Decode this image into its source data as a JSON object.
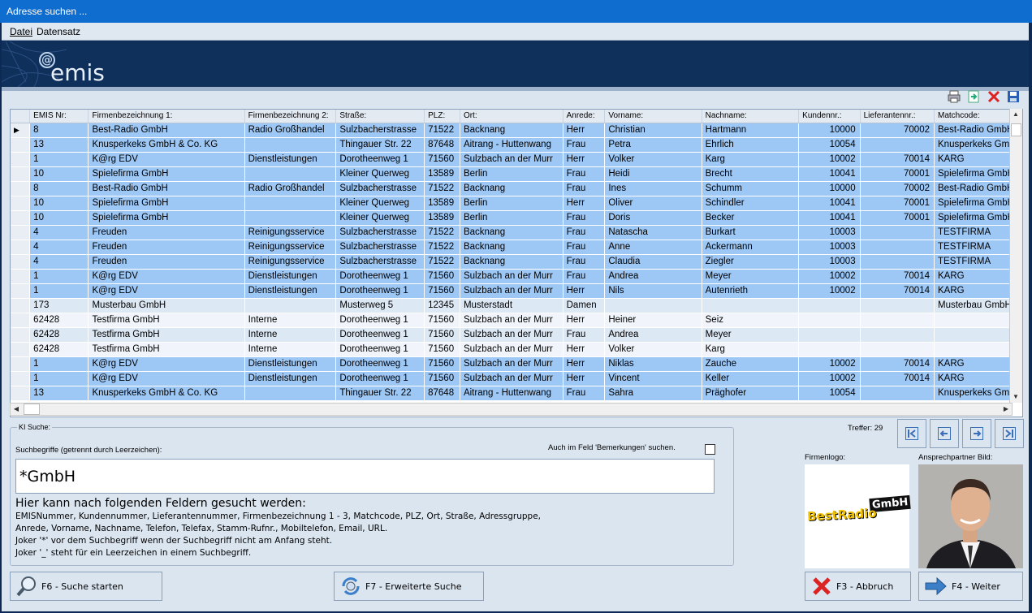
{
  "window": {
    "title": "Adresse suchen ..."
  },
  "menu": {
    "items": [
      "Datei",
      "Datensatz"
    ]
  },
  "logo": {
    "text": "emis"
  },
  "grid": {
    "columns": [
      "EMIS Nr:",
      "Firmenbezeichnung 1:",
      "Firmenbezeichnung 2:",
      "Straße:",
      "PLZ:",
      "Ort:",
      "Anrede:",
      "Vorname:",
      "Nachname:",
      "Kundennr.:",
      "Lieferantennr.:",
      "Matchcode:"
    ],
    "rows": [
      [
        "8",
        "Best-Radio GmbH",
        "Radio Großhandel",
        "Sulzbacherstrasse",
        "71522",
        "Backnang",
        "Herr",
        "Christian",
        "Hartmann",
        "10000",
        "70002",
        "Best-Radio GmbH"
      ],
      [
        "13",
        "Knusperkeks GmbH & Co. KG",
        "",
        "Thingauer Str. 22",
        "87648",
        "Aitrang - Huttenwang",
        "Frau",
        "Petra",
        "Ehrlich",
        "10054",
        "",
        "Knusperkeks GmbH"
      ],
      [
        "1",
        "K@rg EDV",
        "Dienstleistungen",
        "Dorotheenweg 1",
        "71560",
        "Sulzbach an der Murr",
        "Herr",
        "Volker",
        "Karg",
        "10002",
        "70014",
        "KARG"
      ],
      [
        "10",
        "Spielefirma GmbH",
        "",
        "Kleiner Querweg",
        "13589",
        "Berlin",
        "Frau",
        "Heidi",
        "Brecht",
        "10041",
        "70001",
        "Spielefirma GmbH"
      ],
      [
        "8",
        "Best-Radio GmbH",
        "Radio Großhandel",
        "Sulzbacherstrasse",
        "71522",
        "Backnang",
        "Frau",
        "Ines",
        "Schumm",
        "10000",
        "70002",
        "Best-Radio GmbH"
      ],
      [
        "10",
        "Spielefirma GmbH",
        "",
        "Kleiner Querweg",
        "13589",
        "Berlin",
        "Herr",
        "Oliver",
        "Schindler",
        "10041",
        "70001",
        "Spielefirma GmbH"
      ],
      [
        "10",
        "Spielefirma GmbH",
        "",
        "Kleiner Querweg",
        "13589",
        "Berlin",
        "Frau",
        "Doris",
        "Becker",
        "10041",
        "70001",
        "Spielefirma GmbH"
      ],
      [
        "4",
        "Freuden",
        "Reinigungsservice",
        "Sulzbacherstrasse",
        "71522",
        "Backnang",
        "Frau",
        "Natascha",
        "Burkart",
        "10003",
        "",
        "TESTFIRMA"
      ],
      [
        "4",
        "Freuden",
        "Reinigungsservice",
        "Sulzbacherstrasse",
        "71522",
        "Backnang",
        "Frau",
        "Anne",
        "Ackermann",
        "10003",
        "",
        "TESTFIRMA"
      ],
      [
        "4",
        "Freuden",
        "Reinigungsservice",
        "Sulzbacherstrasse",
        "71522",
        "Backnang",
        "Frau",
        "Claudia",
        "Ziegler",
        "10003",
        "",
        "TESTFIRMA"
      ],
      [
        "1",
        "K@rg EDV",
        "Dienstleistungen",
        "Dorotheenweg 1",
        "71560",
        "Sulzbach an der Murr",
        "Frau",
        "Andrea",
        "Meyer",
        "10002",
        "70014",
        "KARG"
      ],
      [
        "1",
        "K@rg EDV",
        "Dienstleistungen",
        "Dorotheenweg 1",
        "71560",
        "Sulzbach an der Murr",
        "Herr",
        "Nils",
        "Autenrieth",
        "10002",
        "70014",
        "KARG"
      ],
      [
        "173",
        "Musterbau GmbH",
        "",
        "Musterweg 5",
        "12345",
        "Musterstadt",
        "Damen",
        "",
        "",
        "",
        "",
        "Musterbau GmbH"
      ],
      [
        "62428",
        "Testfirma GmbH",
        "Interne",
        "Dorotheenweg 1",
        "71560",
        "Sulzbach an der Murr",
        "Herr",
        "Heiner",
        "Seiz",
        "",
        "",
        ""
      ],
      [
        "62428",
        "Testfirma GmbH",
        "Interne",
        "Dorotheenweg 1",
        "71560",
        "Sulzbach an der Murr",
        "Frau",
        "Andrea",
        "Meyer",
        "",
        "",
        ""
      ],
      [
        "62428",
        "Testfirma GmbH",
        "Interne",
        "Dorotheenweg 1",
        "71560",
        "Sulzbach an der Murr",
        "Herr",
        "Volker",
        "Karg",
        "",
        "",
        ""
      ],
      [
        "1",
        "K@rg EDV",
        "Dienstleistungen",
        "Dorotheenweg 1",
        "71560",
        "Sulzbach an der Murr",
        "Herr",
        "Niklas",
        "Zauche",
        "10002",
        "70014",
        "KARG"
      ],
      [
        "1",
        "K@rg EDV",
        "Dienstleistungen",
        "Dorotheenweg 1",
        "71560",
        "Sulzbach an der Murr",
        "Herr",
        "Vincent",
        "Keller",
        "10002",
        "70014",
        "KARG"
      ],
      [
        "13",
        "Knusperkeks GmbH & Co. KG",
        "",
        "Thingauer Str. 22",
        "87648",
        "Aitrang - Huttenwang",
        "Frau",
        "Sahra",
        "Präghofer",
        "10054",
        "",
        "Knusperkeks GmbH"
      ]
    ],
    "row_styles": [
      "hl",
      "hl",
      "hl",
      "hl",
      "hl",
      "hl",
      "hl",
      "hl",
      "hl",
      "hl",
      "hl",
      "hl",
      "alt",
      "plain",
      "alt",
      "plain",
      "hl",
      "hl",
      "hl"
    ]
  },
  "treffer": "Treffer: 29",
  "ki": {
    "legend": "KI Suche:",
    "search_label": "Suchbegriffe (getrennt durch Leerzeichen):",
    "remarks_label": "Auch im Feld 'Bemerkungen' suchen.",
    "search_value": "*GmbH",
    "help_title": "Hier kann nach folgenden Feldern gesucht werden:",
    "help_lines": [
      "EMISNummer, Kundennummer, Lieferantennummer, Firmenbezeichnung 1 - 3, Matchcode, PLZ, Ort, Straße, Adressgruppe,",
      "Anrede, Vorname, Nachname, Telefon, Telefax, Stamm-Rufnr., Mobiltelefon, Email, URL.",
      "Joker '*' vor dem Suchbegriff wenn der Suchbegriff nicht am Anfang steht.",
      "Joker '_' steht für ein Leerzeichen in einem Suchbegriff."
    ]
  },
  "firmenlogo": {
    "label": "Firmenlogo:",
    "text1": "BestRadio",
    "text2": "GmbH"
  },
  "partner": {
    "label": "Ansprechpartner Bild:"
  },
  "buttons": {
    "search": "F6 - Suche starten",
    "extended": "F7 - Erweiterte Suche",
    "cancel": "F3 - Abbruch",
    "next": "F4 - Weiter"
  },
  "colors": {
    "highlight_row": "#9dc7f5",
    "banner": "#10305c",
    "titlebar": "#0f6dd0"
  }
}
